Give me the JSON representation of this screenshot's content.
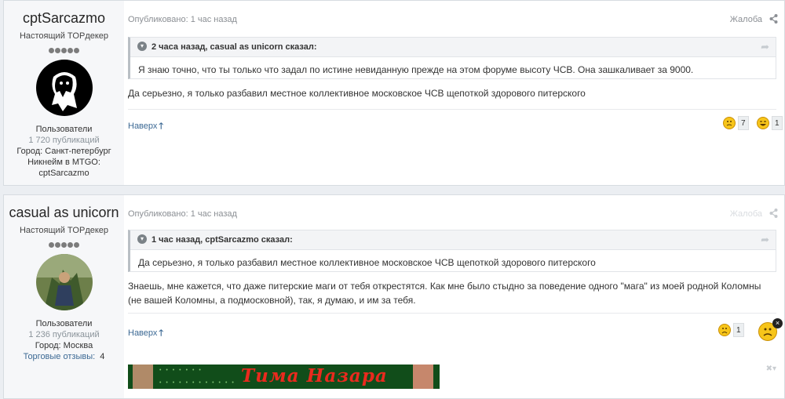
{
  "posts": [
    {
      "author": "cptSarcazmo",
      "rank": "Настоящий TOPдекер",
      "group": "Пользователи",
      "post_count": "1 720 публикаций",
      "city": "Город: Санкт-петербург",
      "mtgo_label": "Никнейм в MTGO:",
      "mtgo_value": "cptSarcazmo",
      "posted": "Опубликовано: 1 час назад",
      "report": "Жалоба",
      "quote_header": "2 часа назад, casual as unicorn сказал:",
      "quote_text": "Я знаю точно, что ты только что задал по истине невиданную прежде на этом форуме высоту ЧСВ. Она зашкаливает за 9000.",
      "body": "Да серьезно, я только разбавил местное коллективное московское ЧСВ щепоткой здорового питерского",
      "up_label": "Наверх",
      "reactions": [
        {
          "icon": "confused-emoji-icon",
          "count": "7"
        },
        {
          "icon": "laughing-emoji-icon",
          "count": "1"
        }
      ]
    },
    {
      "author": "casual as unicorn",
      "rank": "Настоящий TOPдекер",
      "group": "Пользователи",
      "post_count": "1 236 публикаций",
      "city": "Город: Москва",
      "trade_label": "Торговые отзывы:",
      "trade_value": "4",
      "posted": "Опубликовано: 1 час назад",
      "report": "Жалоба",
      "quote_header": "1 час назад, cptSarcazmo сказал:",
      "quote_text": "Да серьезно, я только разбавил местное коллективное московское ЧСВ щепоткой здорового питерского",
      "body": "Знаешь, мне кажется, что даже питерские маги от тебя открестятся. Как мне было стыдно за поведение одного \"мага\" из моей родной Коломны (не вашей Коломны, а подмосковной), так, я думаю, и им за тебя.",
      "up_label": "Наверх",
      "reactions": [
        {
          "icon": "sad-emoji-icon",
          "count": "1"
        }
      ],
      "signature_banner_text": "Тима Назара"
    }
  ],
  "colors": {
    "accent": "#3c6994",
    "author_bg": "#f6f7f9",
    "page_bg": "#ebeef2",
    "banner_text": "#ea2a1e",
    "banner_bg": "#114d1a"
  }
}
